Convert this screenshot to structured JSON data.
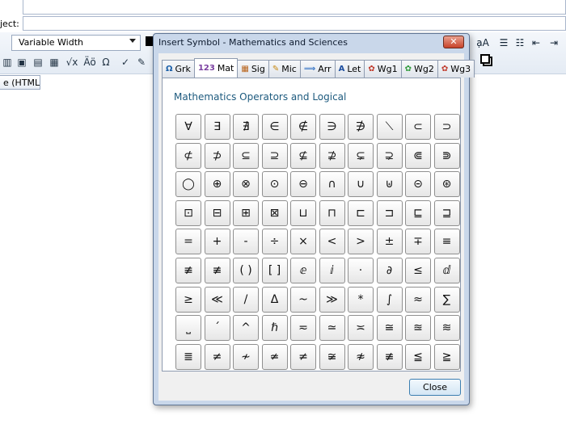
{
  "app": {
    "subject_label": "ject:",
    "font_select": "Variable Width",
    "html_tab": "e (HTML)",
    "left_tools": [
      "▥",
      "▣",
      "▤",
      "▦",
      "√x",
      "Äö",
      "Ω",
      "✓",
      "✎"
    ],
    "right_tools": [
      "ạA",
      "☰",
      "☷",
      "⇤",
      "⇥"
    ]
  },
  "dialog": {
    "title": "Insert Symbol - Mathematics and Sciences",
    "close_x": "✕",
    "tabs": [
      {
        "icon": "Ω",
        "label": "Grk",
        "color": "#1b5fa8"
      },
      {
        "icon": "123",
        "label": "Mat",
        "color": "#7a3fa0"
      },
      {
        "icon": "▦",
        "label": "Sig",
        "color": "#b8631b"
      },
      {
        "icon": "✎",
        "label": "Mic",
        "color": "#c98a14"
      },
      {
        "icon": "⟹",
        "label": "Arr",
        "color": "#2f6fc4"
      },
      {
        "icon": "A",
        "label": "Let",
        "color": "#1e4fa0"
      },
      {
        "icon": "✿",
        "label": "Wg1",
        "color": "#c0392b"
      },
      {
        "icon": "✿",
        "label": "Wg2",
        "color": "#2e9a3a"
      },
      {
        "icon": "✿",
        "label": "Wg3",
        "color": "#c0392b"
      }
    ],
    "active_tab": "Mat",
    "section_title": "Mathematics Operators and Logical",
    "symbols": [
      "∀",
      "∃",
      "∄",
      "∈",
      "∉",
      "∋",
      "∌",
      "⟍",
      "⊂",
      "⊃",
      "⊄",
      "⊅",
      "⊆",
      "⊇",
      "⊈",
      "⊉",
      "⊊",
      "⊋",
      "⋐",
      "⋑",
      "◯",
      "⊕",
      "⊗",
      "⊙",
      "⊖",
      "∩",
      "∪",
      "⊎",
      "⊝",
      "⊛",
      "⊡",
      "⊟",
      "⊞",
      "⊠",
      "⊔",
      "⊓",
      "⊏",
      "⊐",
      "⊑",
      "⊒",
      "=",
      "+",
      "-",
      "÷",
      "×",
      "<",
      ">",
      "±",
      "∓",
      "≡",
      "≢",
      "≢",
      "( )",
      "[ ]",
      "ⅇ",
      "ⅈ",
      "·",
      "∂",
      "≤",
      "ⅆ",
      "≥",
      "≪",
      "/",
      "Δ",
      "~",
      "≫",
      "*",
      "∫",
      "≈",
      "∑",
      "⎵",
      "´",
      "^",
      "ℏ",
      "≂",
      "≃",
      "≍",
      "≅",
      "≊",
      "≋",
      "≣",
      "≠",
      "≁",
      "≄",
      "≠",
      "≆",
      "≉",
      "≢",
      "≦",
      "≧"
    ],
    "close_button": "Close"
  }
}
